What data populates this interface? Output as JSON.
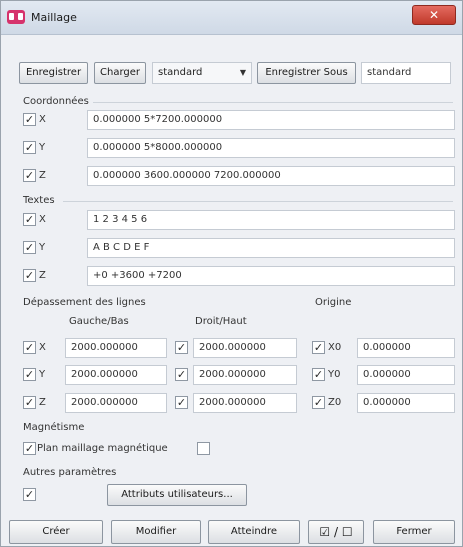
{
  "window": {
    "title": "Maillage",
    "close_glyph": "✕"
  },
  "toolbar": {
    "save_label": "Enregistrer",
    "load_label": "Charger",
    "preset_value": "standard",
    "save_as_label": "Enregistrer Sous",
    "save_as_name": "standard"
  },
  "coords": {
    "title": "Coordonnées",
    "x_label": "X",
    "x_value": "0.000000 5*7200.000000",
    "y_label": "Y",
    "y_value": "0.000000 5*8000.000000",
    "z_label": "Z",
    "z_value": "0.000000 3600.000000 7200.000000",
    "check": "✓"
  },
  "texts": {
    "title": "Textes",
    "x_label": "X",
    "x_value": "1 2 3 4 5 6",
    "y_label": "Y",
    "y_value": "A B C D E F",
    "z_label": "Z",
    "z_value": "+0 +3600 +7200"
  },
  "overflow": {
    "title": "Dépassement des lignes",
    "left_bottom": "Gauche/Bas",
    "right_top": "Droit/Haut",
    "x_label": "X",
    "y_label": "Y",
    "z_label": "Z",
    "x_left": "2000.000000",
    "x_right": "2000.000000",
    "y_left": "2000.000000",
    "y_right": "2000.000000",
    "z_left": "2000.000000",
    "z_right": "2000.000000"
  },
  "origin": {
    "title": "Origine",
    "x0_label": "X0",
    "x0_value": "0.000000",
    "y0_label": "Y0",
    "y0_value": "0.000000",
    "z0_label": "Z0",
    "z0_value": "0.000000"
  },
  "magnetism": {
    "title": "Magnétisme",
    "plan_label": "Plan maillage magnétique"
  },
  "other": {
    "title": "Autres paramètres",
    "user_attrs_label": "Attributs utilisateurs..."
  },
  "footer": {
    "create_label": "Créer",
    "modify_label": "Modifier",
    "reach_label": "Atteindre",
    "toggle_label": "☑ / ☐",
    "close_label": "Fermer"
  }
}
